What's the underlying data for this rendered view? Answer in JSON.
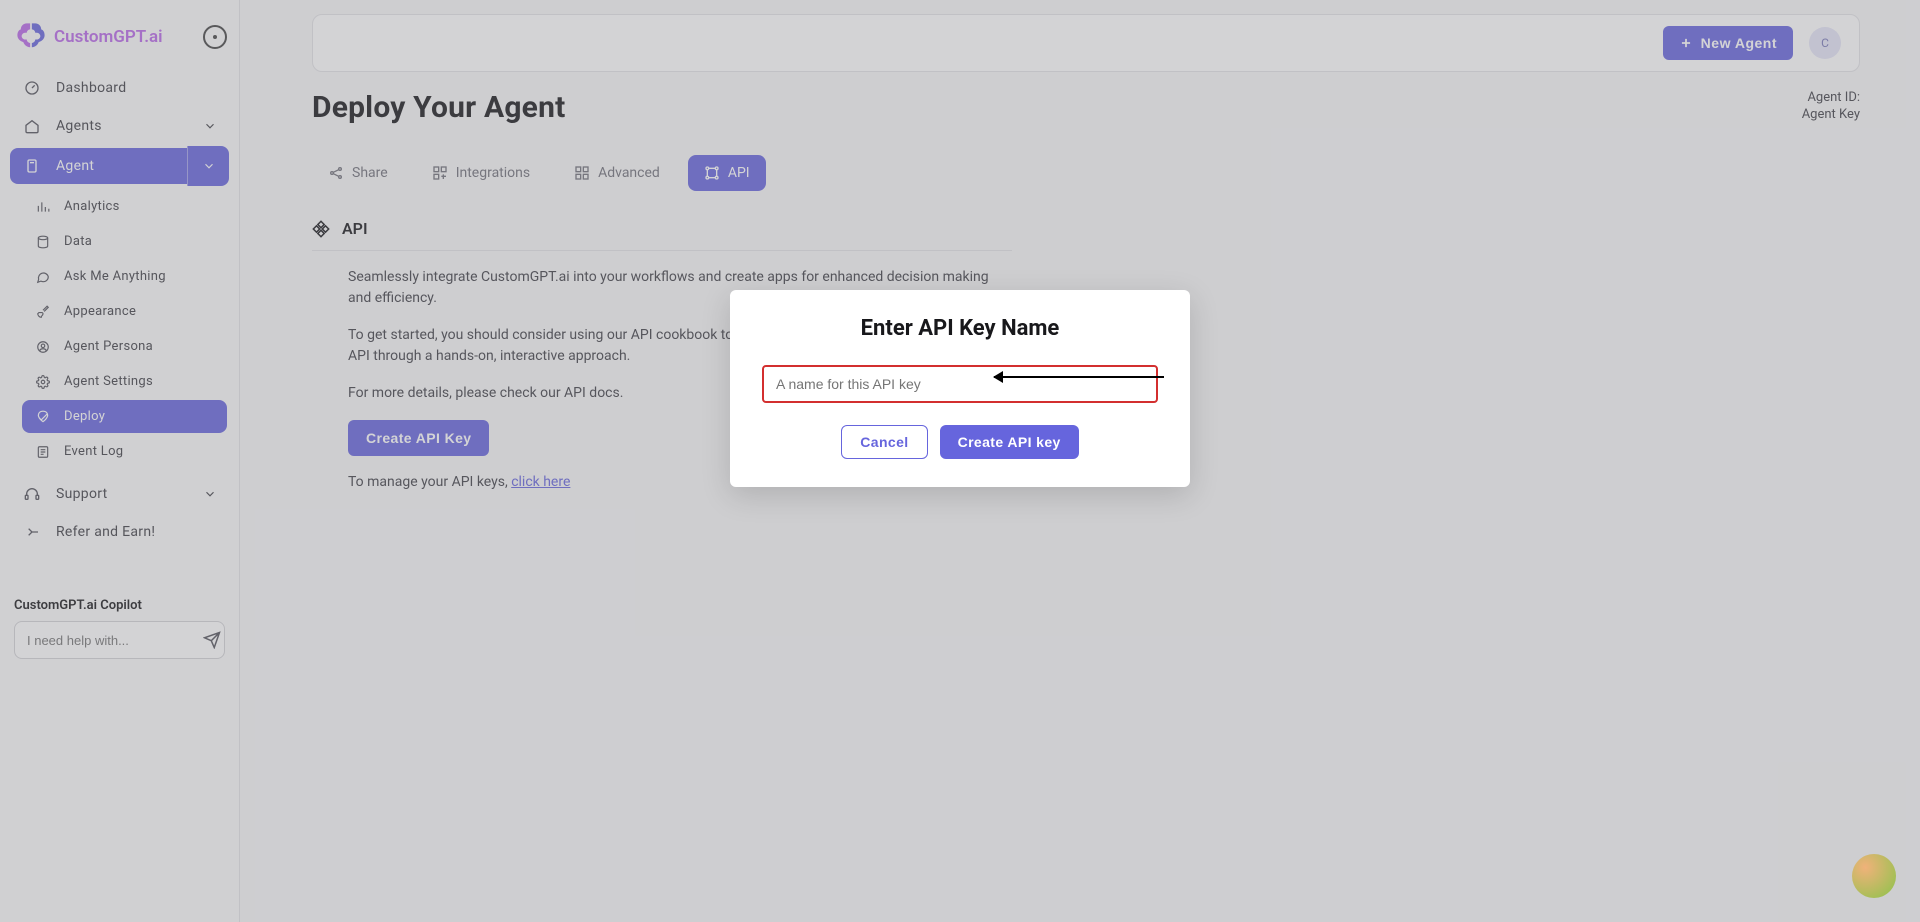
{
  "brand": "CustomGPT.ai",
  "sidebar": {
    "dashboard": "Dashboard",
    "agents": "Agents",
    "agent": "Agent",
    "sub": {
      "analytics": "Analytics",
      "data": "Data",
      "ask": "Ask Me Anything",
      "appearance": "Appearance",
      "persona": "Agent Persona",
      "settings": "Agent Settings",
      "deploy": "Deploy",
      "eventlog": "Event Log"
    },
    "support": "Support",
    "refer": "Refer and Earn!"
  },
  "copilot": {
    "title": "CustomGPT.ai Copilot",
    "placeholder": "I need help with..."
  },
  "topbar": {
    "new_agent": "New Agent",
    "avatar_initial": "C"
  },
  "page": {
    "title": "Deploy Your Agent",
    "agent_id_label": "Agent ID:",
    "agent_key_label": "Agent Key"
  },
  "tabs": {
    "share": "Share",
    "integrations": "Integrations",
    "advanced": "Advanced",
    "api": "API"
  },
  "api_section": {
    "heading": "API",
    "p1": "Seamlessly integrate CustomGPT.ai into your workflows and create apps for enhanced decision making and efficiency.",
    "p2": "To get started, you should consider using our API cookbook to learn about how to use the CustomGPT.ai API through a hands-on, interactive approach.",
    "p3": "For more details, please check our API docs.",
    "create_btn": "Create API Key",
    "manage_prefix": "To manage your API keys, ",
    "manage_link": "click here"
  },
  "modal": {
    "title": "Enter API Key Name",
    "placeholder": "A name for this API key",
    "cancel": "Cancel",
    "create": "Create API key"
  }
}
